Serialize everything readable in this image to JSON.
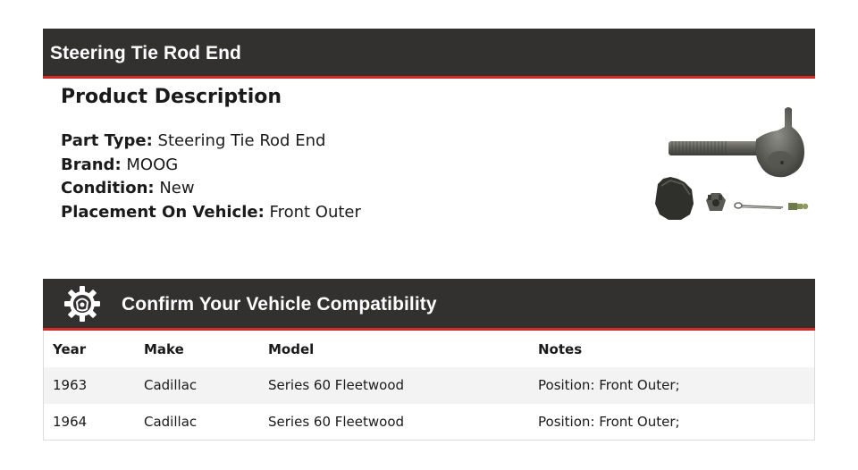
{
  "header": {
    "title": "Steering Tie Rod End"
  },
  "description": {
    "heading": "Product Description",
    "properties": [
      {
        "label": "Part Type:",
        "value": "Steering Tie Rod End"
      },
      {
        "label": "Brand:",
        "value": "MOOG"
      },
      {
        "label": "Condition:",
        "value": "New"
      },
      {
        "label": "Placement On Vehicle:",
        "value": "Front Outer"
      }
    ]
  },
  "product_image": {
    "icon": "tie-rod-end-photo"
  },
  "compatibility": {
    "title": "Confirm Your Vehicle Compatibility",
    "icon": "gear-icon",
    "columns": [
      "Year",
      "Make",
      "Model",
      "Notes"
    ],
    "rows": [
      [
        "1963",
        "Cadillac",
        "Series 60 Fleetwood",
        "Position: Front Outer;"
      ],
      [
        "1964",
        "Cadillac",
        "Series 60 Fleetwood",
        "Position: Front Outer;"
      ]
    ]
  },
  "colors": {
    "banner": "#333030",
    "accent": "#d42a2a"
  }
}
